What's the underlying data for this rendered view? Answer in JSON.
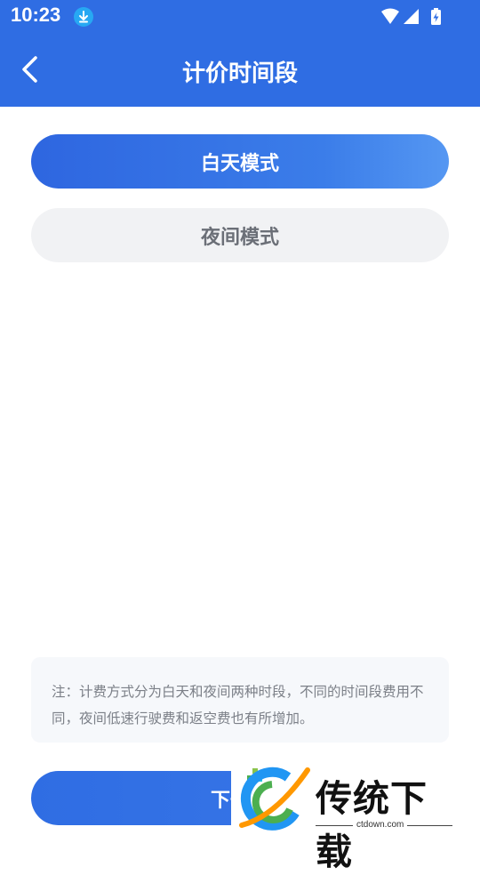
{
  "status_bar": {
    "time": "10:23",
    "icons": [
      "download-badge-icon",
      "wifi-icon",
      "signal-icon",
      "battery-charging-icon"
    ]
  },
  "toolbar": {
    "back_icon": "back-arrow-icon",
    "title": "计价时间段"
  },
  "modes": [
    {
      "label": "白天模式",
      "selected": true
    },
    {
      "label": "夜间模式",
      "selected": false
    }
  ],
  "note": {
    "text": "注：计费方式分为白天和夜间两种时段，不同的时间段费用不同，夜间低速行驶费和返空费也有所增加。"
  },
  "next_button": {
    "label": "下一步"
  },
  "watermark": {
    "title": "传统下载",
    "url": "ctdown.com"
  },
  "colors": {
    "primary": "#2f6de3",
    "unselected_bg": "#f1f2f4",
    "note_bg": "#f6f8fb"
  }
}
